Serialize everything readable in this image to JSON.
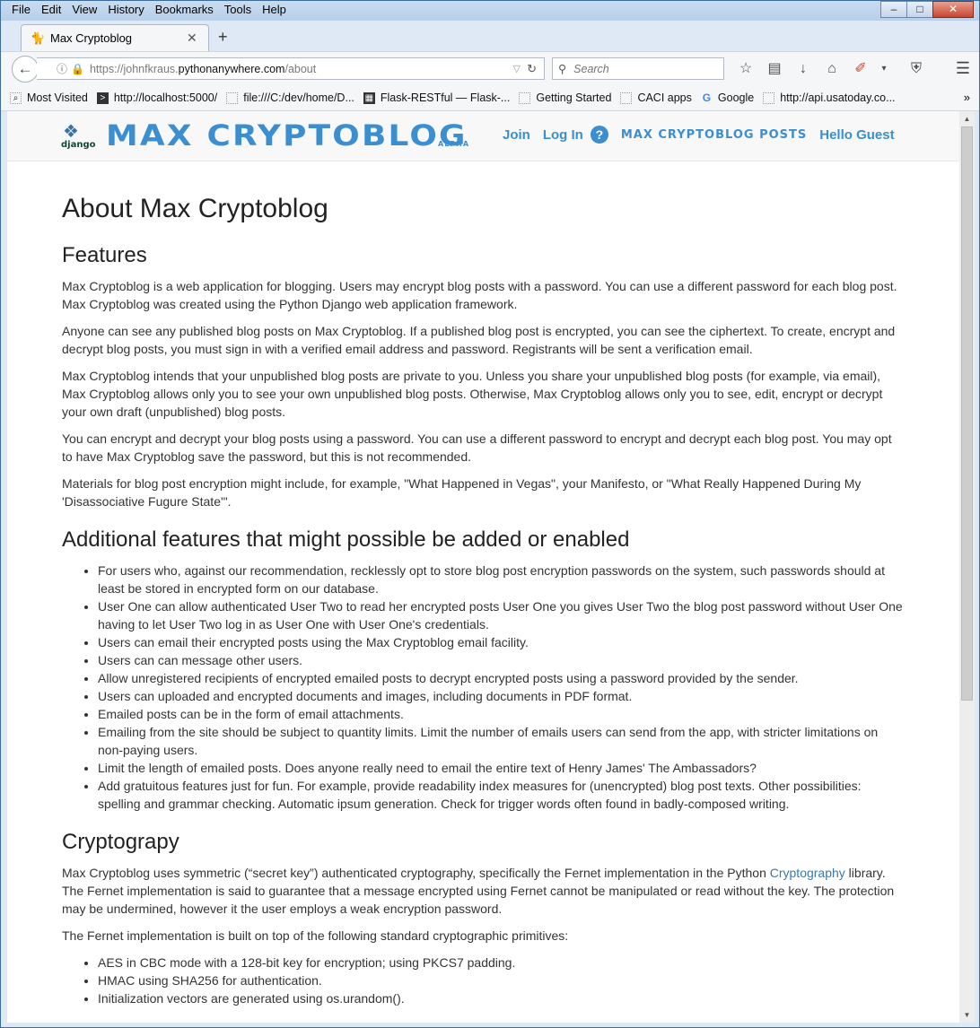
{
  "menubar": [
    "File",
    "Edit",
    "View",
    "History",
    "Bookmarks",
    "Tools",
    "Help"
  ],
  "tab": {
    "title": "Max Cryptoblog"
  },
  "navbar": {
    "url_prefix": "https://johnfkraus.",
    "url_domain": "pythonanywhere.com",
    "url_path": "/about",
    "search_placeholder": "Search"
  },
  "bookmarks": [
    "Most Visited",
    "http://localhost:5000/",
    "file:///C:/dev/home/D...",
    "Flask-RESTful — Flask-...",
    "Getting Started",
    "CACI apps",
    "Google",
    "http://api.usatoday.co..."
  ],
  "site": {
    "brand": "MAX CRYPTOBLOG",
    "alpha": "ALPHA",
    "django_label": "django",
    "nav": {
      "join": "Join",
      "login": "Log In",
      "help": "?",
      "posts": "MAX CRYPTOBLOG POSTS",
      "hello": "Hello Guest"
    }
  },
  "page": {
    "title": "About Max Cryptoblog",
    "features_heading": "Features",
    "features": [
      "Max Cryptoblog is a web application for blogging. Users may encrypt blog posts with a password. You can use a different password for each blog post. Max Cryptoblog was created using the Python Django web application framework.",
      "Anyone can see any published blog posts on Max Cryptoblog. If a published blog post is encrypted, you can see the ciphertext. To create, encrypt and decrypt blog posts, you must sign in with a verified email address and password. Registrants will be sent a verification email.",
      "Max Cryptoblog intends that your unpublished blog posts are private to you. Unless you share your unpublished blog posts (for example, via email), Max Cryptoblog allows only you to see your own unpublished blog posts. Otherwise, Max Cryptoblog allows only you to see, edit, encrypt or decrypt your own draft (unpublished) blog posts.",
      "You can encrypt and decrypt your blog posts using a password. You can use a different password to encrypt and decrypt each blog post. You may opt to have Max Cryptoblog save the password, but this is not recommended.",
      "Materials for blog post encryption might include, for example, \"What Happened in Vegas\", your Manifesto, or \"What Really Happened During My 'Disassociative Fugure State'\"."
    ],
    "additional_heading": "Additional features that might possible be added or enabled",
    "additional": [
      "For users who, against our recommendation, recklessly opt to store blog post encryption passwords on the system, such passwords should at least be stored in encrypted form on our database.",
      "User One can allow authenticated User Two to read her encrypted posts User One you gives User Two the blog post password without User One having to let User Two log in as User One with User One's credentials.",
      "Users can email their encrypted posts using the Max Cryptoblog email facility.",
      "Users can can message other users.",
      "Allow unregistered recipients of encrypted emailed posts to decrypt encrypted posts using a password provided by the sender.",
      "Users can uploaded and encrypted documents and images, including documents in PDF format.",
      "Emailed posts can be in the form of email attachments.",
      "Emailing from the site should be subject to quantity limits. Limit the number of emails users can send from the app, with stricter limitations on non-paying users.",
      "Limit the length of emailed posts. Does anyone really need to email the entire text of Henry James' The Ambassadors?",
      "Add gratuitous features just for fun. For example, provide readability index measures for (unencrypted) blog post texts. Other possibilities: spelling and grammar checking. Automatic ipsum generation. Check for trigger words often found in badly-composed writing."
    ],
    "crypto_heading": "Cryptograpy",
    "crypto_p1_before": "Max Cryptoblog uses symmetric (“secret key”) authenticated cryptography, specifically the Fernet implementation in the Python ",
    "crypto_p1_link": "Cryptography",
    "crypto_p1_after": " library. The Fernet implementation is said to guarantee that a message encrypted using Fernet cannot be manipulated or read without the key. The protection may be undermined, however it the user employs a weak encryption password.",
    "crypto_p2": "The Fernet implementation is built on top of the following standard cryptographic primitives:",
    "primitives": [
      "AES in CBC mode with a 128-bit key for encryption; using PKCS7 padding.",
      "HMAC using SHA256 for authentication.",
      "Initialization vectors are generated using os.urandom()."
    ]
  }
}
